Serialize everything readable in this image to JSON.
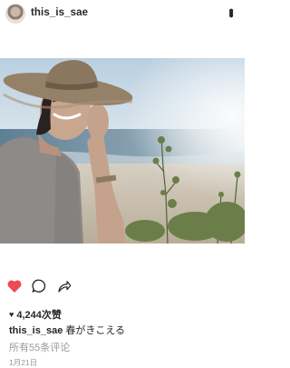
{
  "post": {
    "username": "this_is_sae",
    "more_glyph": "•••",
    "icons": {
      "like": "heart-filled-icon",
      "comment": "comment-bubble-icon",
      "share": "share-arrow-icon",
      "more": "more-options-icon"
    },
    "like_color": "#ed4956",
    "likes_heart": "♥",
    "likes_text": "4,244次赞",
    "caption_user": "this_is_sae",
    "caption_text": "春がきこえる",
    "view_comments": "所有55条评论",
    "date": "1月21日"
  }
}
